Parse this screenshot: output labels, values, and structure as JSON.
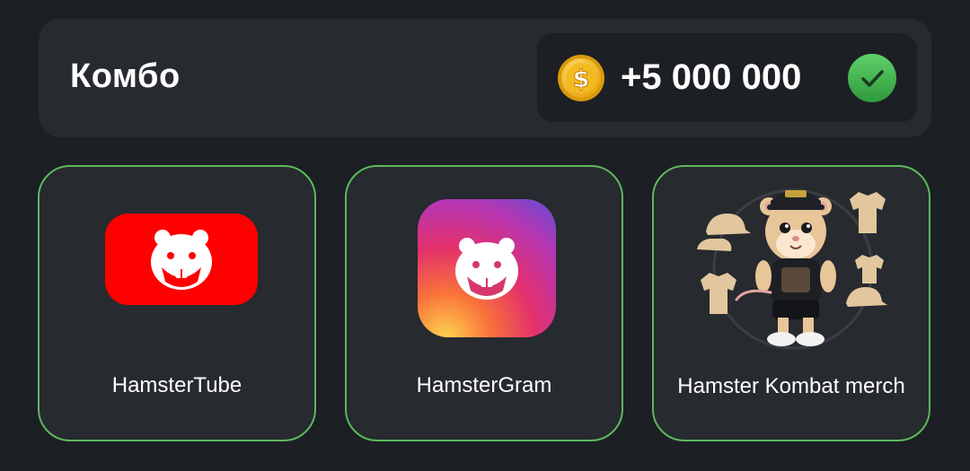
{
  "combo": {
    "title": "Комбо",
    "reward_amount": "+5 000 000",
    "coin_icon": "dollar-coin-icon",
    "status_icon": "check-circle-icon",
    "status_color": "#3fae4b"
  },
  "cards": [
    {
      "label": "HamsterTube",
      "icon": "hamster-tube-logo",
      "color": "#ff0000"
    },
    {
      "label": "HamsterGram",
      "icon": "hamster-gram-logo"
    },
    {
      "label": "Hamster Kombat merch",
      "icon": "hamster-merch-image"
    }
  ],
  "colors": {
    "background": "#1c1f24",
    "panel": "#272a2f",
    "card_border": "#5cb85c",
    "coin": "#f5c518"
  }
}
